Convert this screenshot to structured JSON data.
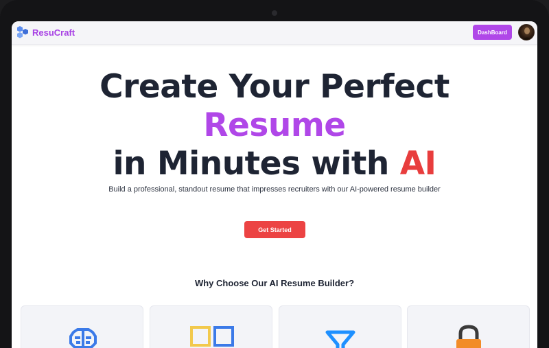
{
  "navbar": {
    "brand": "ResuCraft",
    "logo_icon": "hexagon-cluster-icon",
    "dashboard_label": "DashBoard",
    "avatar": "user-avatar",
    "colors": {
      "brand": "#a740e4",
      "dashboard_button": "#b047e8"
    }
  },
  "hero": {
    "line1": "Create Your Perfect",
    "line2": "Resume",
    "line3_prefix": "in Minutes with ",
    "line3_accent": "AI",
    "subtitle": "Build a professional, standout resume that impresses recruiters with our AI-powered resume builder",
    "cta_label": "Get Started",
    "colors": {
      "title": "#1e2433",
      "accent": "#b047e8",
      "ai": "#e83d3d",
      "cta": "#ec4343"
    }
  },
  "features": {
    "title": "Why Choose Our AI Resume Builder?",
    "cards": [
      {
        "icon": "brain-icon"
      },
      {
        "icon": "template-squares-icon"
      },
      {
        "icon": "filter-funnel-icon"
      },
      {
        "icon": "lock-icon"
      }
    ]
  }
}
